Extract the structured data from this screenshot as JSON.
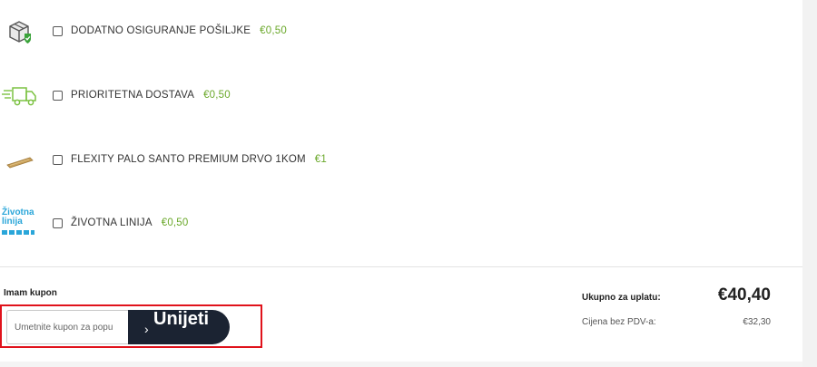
{
  "addons": [
    {
      "label": "DODATNO OSIGURANJE POŠILJKE",
      "price": "€0,50",
      "icon": "package-shield-icon"
    },
    {
      "label": "PRIORITETNA DOSTAVA",
      "price": "€0,50",
      "icon": "fast-delivery-truck-icon"
    },
    {
      "label": "FLEXITY PALO SANTO PREMIUM DRVO 1KOM",
      "price": "€1",
      "icon": "palo-santo-stick-icon"
    },
    {
      "label": "ŽIVOTNA LINIJA",
      "price": "€0,50",
      "icon": "zivotna-linija-logo",
      "logo_text": [
        "Životna",
        "linija"
      ]
    }
  ],
  "coupon": {
    "label": "Imam kupon",
    "placeholder": "Umetnite kupon za popu",
    "apply_label": "Unijeti",
    "apply_arrow": "›"
  },
  "summary": {
    "total_label": "Ukupno za uplatu:",
    "total_value": "€40,40",
    "net_label": "Cijena bez PDV-a:",
    "net_value": "€32,30"
  },
  "colors": {
    "price_green": "#6aa82a",
    "button_dark": "#1b2332",
    "highlight_red": "#e0121b",
    "logo_blue": "#2aa6d9"
  }
}
